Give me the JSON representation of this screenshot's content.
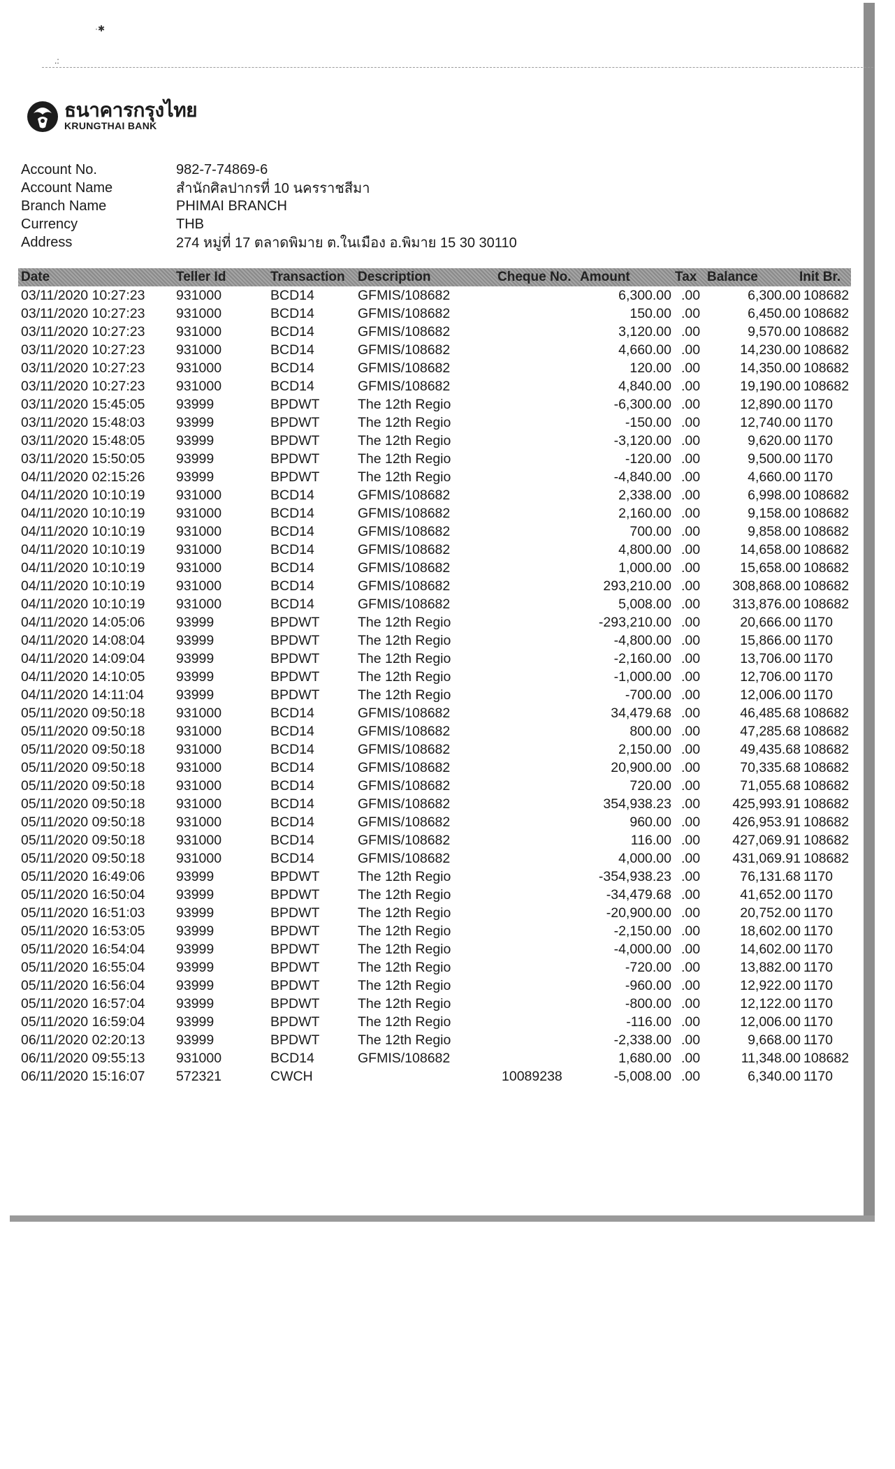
{
  "bank": {
    "name_thai": "ธนาคารกรุงไทย",
    "name_en": "KRUNGTHAI BANK"
  },
  "account": {
    "labels": {
      "number": "Account No.",
      "name": "Account Name",
      "branch": "Branch Name",
      "currency": "Currency",
      "address": "Address"
    },
    "number": "982-7-74869-6",
    "name": "สำนักศิลปากรที่ 10 นครราชสีมา",
    "branch": "PHIMAI BRANCH",
    "currency": "THB",
    "address": "274 หมู่ที่ 17 ตลาดพิมาย ต.ในเมือง อ.พิมาย 15 30 30110"
  },
  "table": {
    "headers": {
      "date": "Date",
      "teller": "Teller Id",
      "transaction": "Transaction",
      "description": "Description",
      "cheque": "Cheque No.",
      "amount": "Amount",
      "tax": "Tax",
      "balance": "Balance",
      "init": "Init Br."
    },
    "rows": [
      [
        "03/11/2020 10:27:23",
        "931000",
        "BCD14",
        "GFMIS/108682",
        "",
        "6,300.00",
        ".00",
        "6,300.00",
        "108682"
      ],
      [
        "03/11/2020 10:27:23",
        "931000",
        "BCD14",
        "GFMIS/108682",
        "",
        "150.00",
        ".00",
        "6,450.00",
        "108682"
      ],
      [
        "03/11/2020 10:27:23",
        "931000",
        "BCD14",
        "GFMIS/108682",
        "",
        "3,120.00",
        ".00",
        "9,570.00",
        "108682"
      ],
      [
        "03/11/2020 10:27:23",
        "931000",
        "BCD14",
        "GFMIS/108682",
        "",
        "4,660.00",
        ".00",
        "14,230.00",
        "108682"
      ],
      [
        "03/11/2020 10:27:23",
        "931000",
        "BCD14",
        "GFMIS/108682",
        "",
        "120.00",
        ".00",
        "14,350.00",
        "108682"
      ],
      [
        "03/11/2020 10:27:23",
        "931000",
        "BCD14",
        "GFMIS/108682",
        "",
        "4,840.00",
        ".00",
        "19,190.00",
        "108682"
      ],
      [
        "03/11/2020 15:45:05",
        "93999",
        "BPDWT",
        "The 12th Regio",
        "",
        "-6,300.00",
        ".00",
        "12,890.00",
        "1170"
      ],
      [
        "03/11/2020 15:48:03",
        "93999",
        "BPDWT",
        "The 12th Regio",
        "",
        "-150.00",
        ".00",
        "12,740.00",
        "1170"
      ],
      [
        "03/11/2020 15:48:05",
        "93999",
        "BPDWT",
        "The 12th Regio",
        "",
        "-3,120.00",
        ".00",
        "9,620.00",
        "1170"
      ],
      [
        "03/11/2020 15:50:05",
        "93999",
        "BPDWT",
        "The 12th Regio",
        "",
        "-120.00",
        ".00",
        "9,500.00",
        "1170"
      ],
      [
        "04/11/2020 02:15:26",
        "93999",
        "BPDWT",
        "The 12th Regio",
        "",
        "-4,840.00",
        ".00",
        "4,660.00",
        "1170"
      ],
      [
        "04/11/2020 10:10:19",
        "931000",
        "BCD14",
        "GFMIS/108682",
        "",
        "2,338.00",
        ".00",
        "6,998.00",
        "108682"
      ],
      [
        "04/11/2020 10:10:19",
        "931000",
        "BCD14",
        "GFMIS/108682",
        "",
        "2,160.00",
        ".00",
        "9,158.00",
        "108682"
      ],
      [
        "04/11/2020 10:10:19",
        "931000",
        "BCD14",
        "GFMIS/108682",
        "",
        "700.00",
        ".00",
        "9,858.00",
        "108682"
      ],
      [
        "04/11/2020 10:10:19",
        "931000",
        "BCD14",
        "GFMIS/108682",
        "",
        "4,800.00",
        ".00",
        "14,658.00",
        "108682"
      ],
      [
        "04/11/2020 10:10:19",
        "931000",
        "BCD14",
        "GFMIS/108682",
        "",
        "1,000.00",
        ".00",
        "15,658.00",
        "108682"
      ],
      [
        "04/11/2020 10:10:19",
        "931000",
        "BCD14",
        "GFMIS/108682",
        "",
        "293,210.00",
        ".00",
        "308,868.00",
        "108682"
      ],
      [
        "04/11/2020 10:10:19",
        "931000",
        "BCD14",
        "GFMIS/108682",
        "",
        "5,008.00",
        ".00",
        "313,876.00",
        "108682"
      ],
      [
        "04/11/2020 14:05:06",
        "93999",
        "BPDWT",
        "The 12th Regio",
        "",
        "-293,210.00",
        ".00",
        "20,666.00",
        "1170"
      ],
      [
        "04/11/2020 14:08:04",
        "93999",
        "BPDWT",
        "The 12th Regio",
        "",
        "-4,800.00",
        ".00",
        "15,866.00",
        "1170"
      ],
      [
        "04/11/2020 14:09:04",
        "93999",
        "BPDWT",
        "The 12th Regio",
        "",
        "-2,160.00",
        ".00",
        "13,706.00",
        "1170"
      ],
      [
        "04/11/2020 14:10:05",
        "93999",
        "BPDWT",
        "The 12th Regio",
        "",
        "-1,000.00",
        ".00",
        "12,706.00",
        "1170"
      ],
      [
        "04/11/2020 14:11:04",
        "93999",
        "BPDWT",
        "The 12th Regio",
        "",
        "-700.00",
        ".00",
        "12,006.00",
        "1170"
      ],
      [
        "05/11/2020 09:50:18",
        "931000",
        "BCD14",
        "GFMIS/108682",
        "",
        "34,479.68",
        ".00",
        "46,485.68",
        "108682"
      ],
      [
        "05/11/2020 09:50:18",
        "931000",
        "BCD14",
        "GFMIS/108682",
        "",
        "800.00",
        ".00",
        "47,285.68",
        "108682"
      ],
      [
        "05/11/2020 09:50:18",
        "931000",
        "BCD14",
        "GFMIS/108682",
        "",
        "2,150.00",
        ".00",
        "49,435.68",
        "108682"
      ],
      [
        "05/11/2020 09:50:18",
        "931000",
        "BCD14",
        "GFMIS/108682",
        "",
        "20,900.00",
        ".00",
        "70,335.68",
        "108682"
      ],
      [
        "05/11/2020 09:50:18",
        "931000",
        "BCD14",
        "GFMIS/108682",
        "",
        "720.00",
        ".00",
        "71,055.68",
        "108682"
      ],
      [
        "05/11/2020 09:50:18",
        "931000",
        "BCD14",
        "GFMIS/108682",
        "",
        "354,938.23",
        ".00",
        "425,993.91",
        "108682"
      ],
      [
        "05/11/2020 09:50:18",
        "931000",
        "BCD14",
        "GFMIS/108682",
        "",
        "960.00",
        ".00",
        "426,953.91",
        "108682"
      ],
      [
        "05/11/2020 09:50:18",
        "931000",
        "BCD14",
        "GFMIS/108682",
        "",
        "116.00",
        ".00",
        "427,069.91",
        "108682"
      ],
      [
        "05/11/2020 09:50:18",
        "931000",
        "BCD14",
        "GFMIS/108682",
        "",
        "4,000.00",
        ".00",
        "431,069.91",
        "108682"
      ],
      [
        "05/11/2020 16:49:06",
        "93999",
        "BPDWT",
        "The 12th Regio",
        "",
        "-354,938.23",
        ".00",
        "76,131.68",
        "1170"
      ],
      [
        "05/11/2020 16:50:04",
        "93999",
        "BPDWT",
        "The 12th Regio",
        "",
        "-34,479.68",
        ".00",
        "41,652.00",
        "1170"
      ],
      [
        "05/11/2020 16:51:03",
        "93999",
        "BPDWT",
        "The 12th Regio",
        "",
        "-20,900.00",
        ".00",
        "20,752.00",
        "1170"
      ],
      [
        "05/11/2020 16:53:05",
        "93999",
        "BPDWT",
        "The 12th Regio",
        "",
        "-2,150.00",
        ".00",
        "18,602.00",
        "1170"
      ],
      [
        "05/11/2020 16:54:04",
        "93999",
        "BPDWT",
        "The 12th Regio",
        "",
        "-4,000.00",
        ".00",
        "14,602.00",
        "1170"
      ],
      [
        "05/11/2020 16:55:04",
        "93999",
        "BPDWT",
        "The 12th Regio",
        "",
        "-720.00",
        ".00",
        "13,882.00",
        "1170"
      ],
      [
        "05/11/2020 16:56:04",
        "93999",
        "BPDWT",
        "The 12th Regio",
        "",
        "-960.00",
        ".00",
        "12,922.00",
        "1170"
      ],
      [
        "05/11/2020 16:57:04",
        "93999",
        "BPDWT",
        "The 12th Regio",
        "",
        "-800.00",
        ".00",
        "12,122.00",
        "1170"
      ],
      [
        "05/11/2020 16:59:04",
        "93999",
        "BPDWT",
        "The 12th Regio",
        "",
        "-116.00",
        ".00",
        "12,006.00",
        "1170"
      ],
      [
        "06/11/2020 02:20:13",
        "93999",
        "BPDWT",
        "The 12th Regio",
        "",
        "-2,338.00",
        ".00",
        "9,668.00",
        "1170"
      ],
      [
        "06/11/2020 09:55:13",
        "931000",
        "BCD14",
        "GFMIS/108682",
        "",
        "1,680.00",
        ".00",
        "11,348.00",
        "108682"
      ],
      [
        "06/11/2020 15:16:07",
        "572321",
        "CWCH",
        "",
        "10089238",
        "-5,008.00",
        ".00",
        "6,340.00",
        "1170"
      ]
    ]
  }
}
